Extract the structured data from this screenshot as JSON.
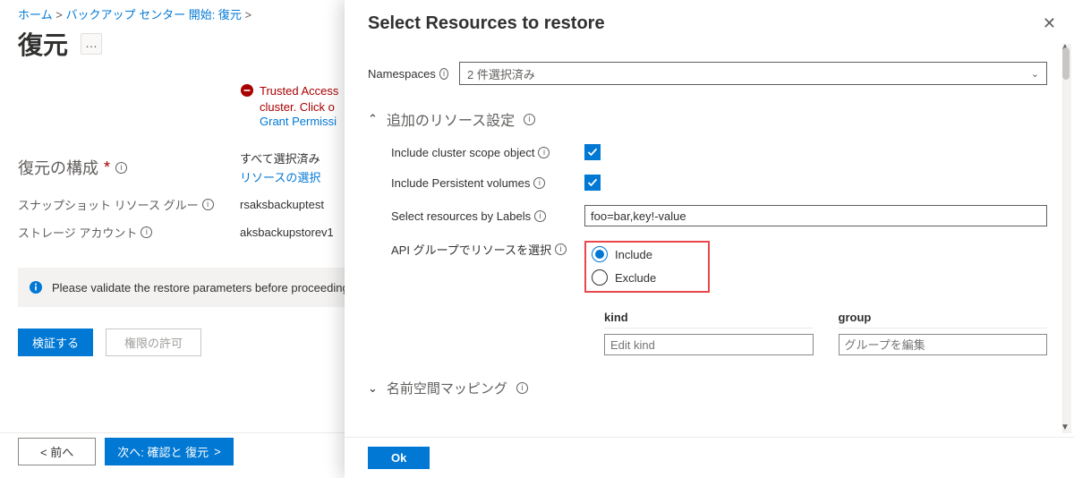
{
  "breadcrumb": {
    "home": "ホーム",
    "center": "バックアップ センター 開始: 復元",
    "sep": ">"
  },
  "page": {
    "title": "復元",
    "ellipsis": "…"
  },
  "warning": {
    "line1": "Trusted Access",
    "line2": "cluster. Click o",
    "link": "Grant Permissi"
  },
  "form": {
    "section_label": "復元の構成",
    "all_selected": "すべて選択済み",
    "resources_link": "リソースの選択",
    "snapshot_rg_label": "スナップショット リソース グルー",
    "snapshot_rg_value": "rsaksbackuptest",
    "storage_label": "ストレージ アカウント",
    "storage_value": "aksbackupstorev1"
  },
  "info_strip": "Please validate the restore parameters before proceeding",
  "buttons": {
    "validate": "検証する",
    "grant": "権限の許可",
    "prev": "前へ",
    "next": "次へ: 確認と  復元"
  },
  "panel": {
    "title": "Select Resources to restore",
    "namespaces_label": "Namespaces",
    "namespaces_value": "2 件選択済み",
    "add_section": "追加のリソース設定",
    "include_cluster": "Include cluster scope object",
    "include_pv": "Include Persistent volumes",
    "labels_label": "Select resources by Labels",
    "labels_value": "foo=bar,key!-value",
    "api_group_label": "API グループでリソースを選択",
    "radio_include": "Include",
    "radio_exclude": "Exclude",
    "kind_header": "kind",
    "group_header": "group",
    "kind_placeholder": "Edit kind",
    "group_placeholder": "グループを編集",
    "ns_mapping": "名前空間マッピング",
    "ok": "Ok"
  }
}
